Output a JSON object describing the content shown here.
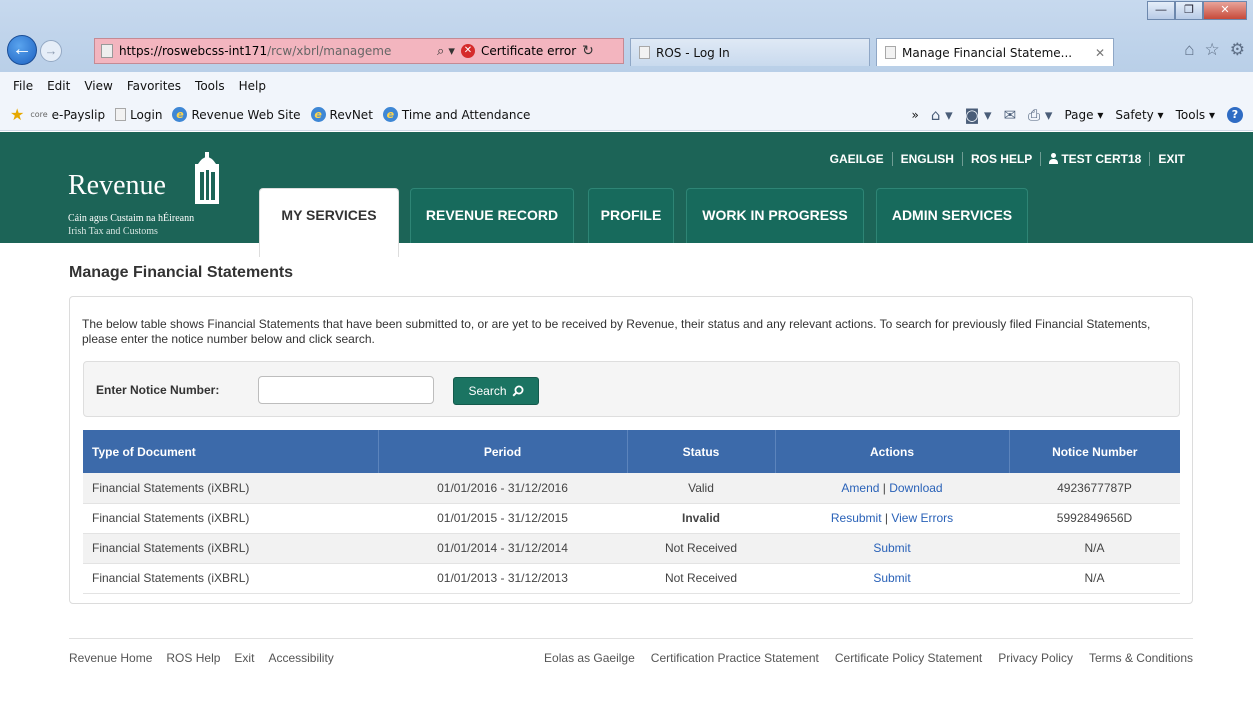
{
  "browser": {
    "address_url_host": "https://roswebcss-int171",
    "address_url_path": "/rcw/xbrl/manageme",
    "certificate_error": "Certificate error",
    "tabs": [
      {
        "title": "ROS - Log In"
      },
      {
        "title": "Manage Financial Stateme...",
        "close": "✕"
      }
    ],
    "window_controls": {
      "minimize": "—",
      "maximize": "❐",
      "close": "✕"
    },
    "menu": [
      "File",
      "Edit",
      "View",
      "Favorites",
      "Tools",
      "Help"
    ],
    "favorites": [
      {
        "label": "e-Payslip",
        "prefix": "core"
      },
      {
        "label": "Login"
      },
      {
        "label": "Revenue Web Site"
      },
      {
        "label": "RevNet"
      },
      {
        "label": "Time and Attendance"
      }
    ],
    "command_bar": {
      "chevron": "»",
      "page": "Page ▾",
      "safety": "Safety ▾",
      "tools": "Tools ▾"
    }
  },
  "site": {
    "logo": {
      "word": "Revenue",
      "sub1": "Cáin agus Custaim na hÉireann",
      "sub2": "Irish Tax and Customs"
    },
    "util_nav": [
      "GAEILGE",
      "ENGLISH",
      "ROS HELP",
      "TEST CERT18",
      "EXIT"
    ],
    "main_tabs": [
      {
        "label": "MY SERVICES"
      },
      {
        "label": "REVENUE RECORD"
      },
      {
        "label": "PROFILE"
      },
      {
        "label": "WORK IN PROGRESS"
      },
      {
        "label": "ADMIN SERVICES"
      }
    ],
    "brand_color": "#1c6457",
    "table_header_color": "#3c6aaa"
  },
  "page": {
    "title": "Manage Financial Statements",
    "intro": "The below table shows Financial Statements that have been submitted to, or are yet to be received by Revenue, their status and any relevant actions. To search for previously filed Financial Statements, please enter the notice number below and click search.",
    "search": {
      "label": "Enter Notice Number:",
      "value": "",
      "button": "Search"
    },
    "table": {
      "headers": [
        "Type of Document",
        "Period",
        "Status",
        "Actions",
        "Notice Number"
      ],
      "rows": [
        {
          "type": "Financial Statements (iXBRL)",
          "period": "01/01/2016 - 31/12/2016",
          "status": "Valid",
          "actions": [
            "Amend",
            "Download"
          ],
          "notice": "4923677787P"
        },
        {
          "type": "Financial Statements (iXBRL)",
          "period": "01/01/2015 - 31/12/2015",
          "status": "Invalid",
          "actions": [
            "Resubmit",
            "View Errors"
          ],
          "notice": "5992849656D"
        },
        {
          "type": "Financial Statements (iXBRL)",
          "period": "01/01/2014 - 31/12/2014",
          "status": "Not Received",
          "actions": [
            "Submit"
          ],
          "notice": "N/A"
        },
        {
          "type": "Financial Statements (iXBRL)",
          "period": "01/01/2013 - 31/12/2013",
          "status": "Not Received",
          "actions": [
            "Submit"
          ],
          "notice": "N/A"
        }
      ]
    }
  },
  "footer": {
    "left": [
      "Revenue Home",
      "ROS Help",
      "Exit",
      "Accessibility"
    ],
    "right": [
      "Eolas as Gaeilge",
      "Certification Practice Statement",
      "Certificate Policy Statement",
      "Privacy Policy",
      "Terms & Conditions"
    ]
  }
}
